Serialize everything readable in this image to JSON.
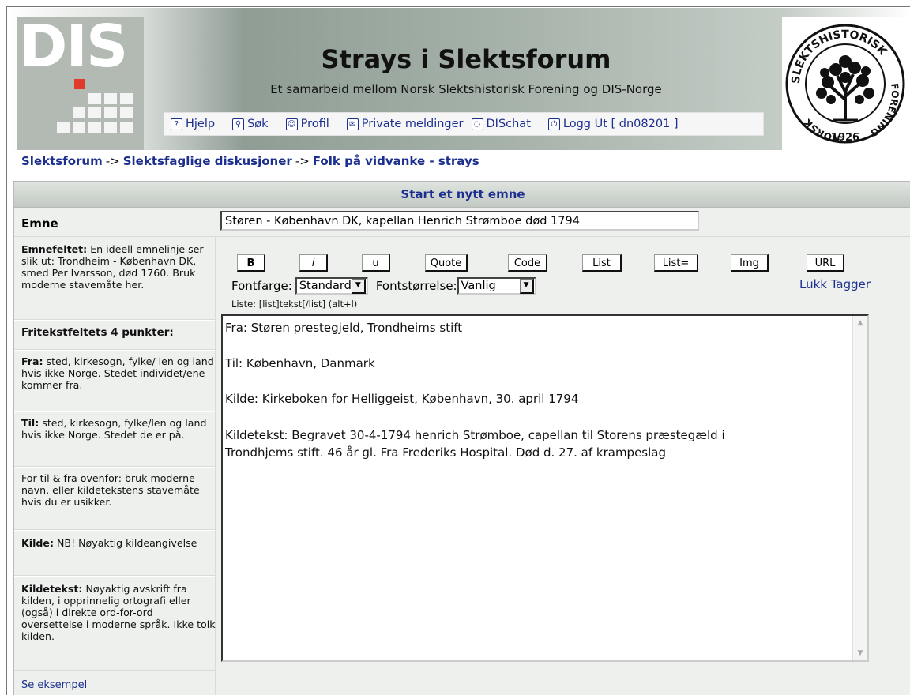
{
  "header": {
    "logo_text": "DIS",
    "title": "Strays i Slektsforum",
    "subtitle": "Et samarbeid mellom Norsk Slektshistorisk Forening og DIS-Norge",
    "seal_top": "SLEKTSHISTORISK",
    "seal_right": "FORENING",
    "seal_left": "NORSK",
    "seal_year": "1926"
  },
  "nav": {
    "help": "Hjelp",
    "search": "Søk",
    "profile": "Profil",
    "messages": "Private meldinger",
    "chat": "DISchat",
    "logout": "Logg Ut [ dn08201 ]"
  },
  "breadcrumb": {
    "root": "Slektsforum",
    "section": "Slektsfaglige diskusjoner",
    "forum": "Folk på vidvanke - strays",
    "sep": "->"
  },
  "form": {
    "title": "Start et nytt emne",
    "subject_label": "Emne",
    "subject_value": "Støren - København DK, kapellan Henrich Strømboe død 1794"
  },
  "help": {
    "emne_head": "Emnefeltet:",
    "emne_text": " En ideell emnelinje ser slik ut: Trondheim - København DK, smed Per Ivarsson, død 1760. Bruk moderne stavemåte her.",
    "fritekst_head": "Fritekstfeltets 4 punkter:",
    "fra_head": "Fra:",
    "fra_text": " sted, kirkesogn, fylke/ len og land hvis ikke Norge. Stedet individet/ene kommer fra.",
    "til_head": "Til:",
    "til_text": " sted, kirkesogn, fylke/len og land hvis ikke Norge. Stedet de er på.",
    "note_text": "For til & fra ovenfor: bruk moderne navn, eller kildetekstens stavemåte hvis du er usikker.",
    "kilde_head": "Kilde:",
    "kilde_text": " NB! Nøyaktig kildeangivelse",
    "kildetekst_head": "Kildetekst:",
    "kildetekst_text": " Nøyaktig avskrift fra kilden, i opprinnelig ortografi eller (også) i direkte ord-for-ord oversettelse i moderne språk. Ikke tolk kilden.",
    "example_link": "Se eksempel"
  },
  "toolbar": {
    "bold": "B",
    "italic": "i",
    "underline": "u",
    "quote": "Quote",
    "code": "Code",
    "list": "List",
    "list_ordered": "List=",
    "img": "Img",
    "url": "URL",
    "font_color_label": "Fontfarge:",
    "font_color_value": "Standard",
    "font_size_label": "Fontstørrelse:",
    "font_size_value": "Vanlig",
    "close_tags": "Lukk Tagger",
    "hint": "Liste: [list]tekst[/list] (alt+l)"
  },
  "message": {
    "body": "Fra: Støren prestegjeld, Trondheims stift\n\nTil: København, Danmark\n\nKilde: Kirkeboken for Helliggeist, København, 30. april 1794\n\nKildetekst: Begravet 30-4-1794 henrich Strømboe, capellan til Storens præstegæld i\nTrondhjems stift. 46 år gl. Fra Frederiks Hospital. Død d. 27. af krampeslag"
  }
}
